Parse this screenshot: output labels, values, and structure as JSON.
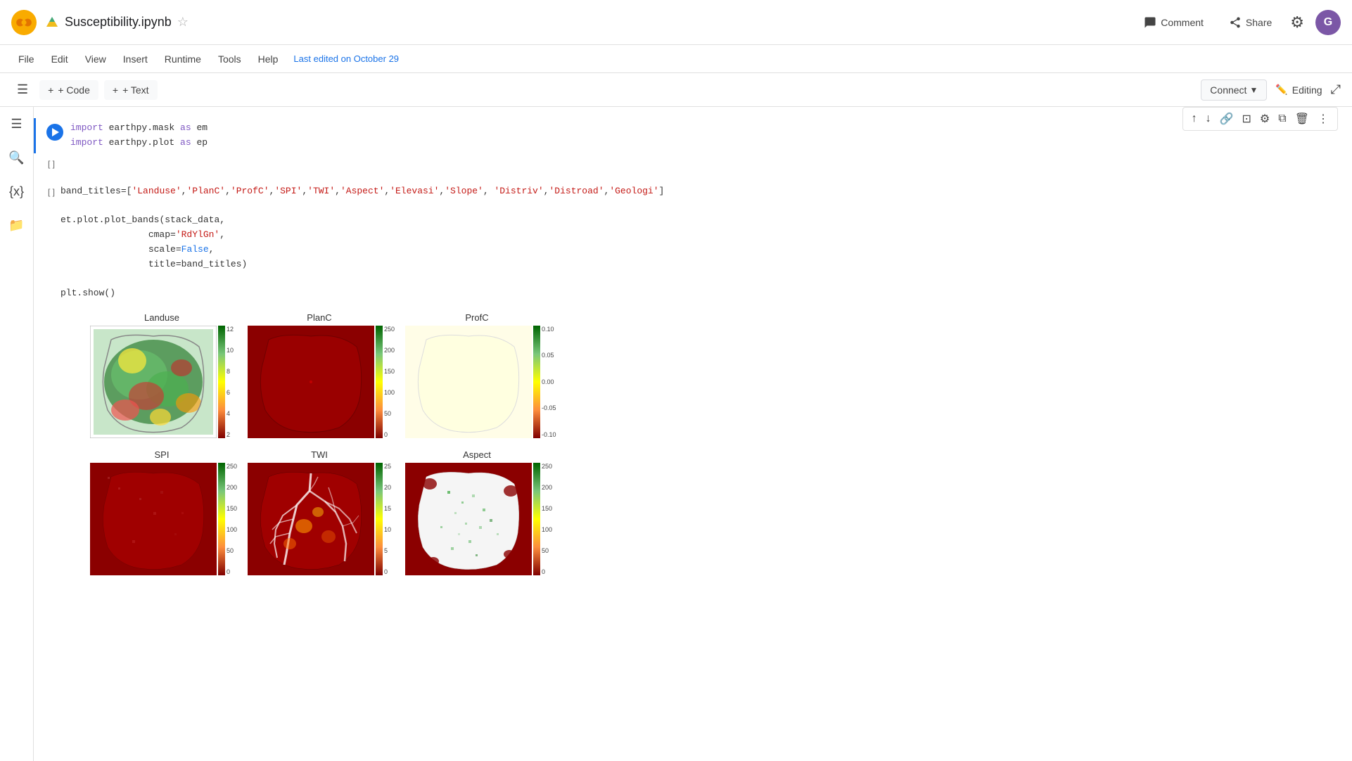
{
  "topbar": {
    "notebook_name": "Susceptibility.ipynb",
    "comment_label": "Comment",
    "share_label": "Share",
    "avatar_letter": "G",
    "last_edited": "Last edited on October 29",
    "editing_label": "Editing"
  },
  "menubar": {
    "items": [
      "File",
      "Edit",
      "View",
      "Insert",
      "Runtime",
      "Tools",
      "Help"
    ]
  },
  "toolbar": {
    "add_code": "+ Code",
    "add_text": "+ Text",
    "connect_label": "Connect"
  },
  "cells": [
    {
      "id": "cell1",
      "type": "code",
      "run_state": "run",
      "bracket": "",
      "lines": [
        "import earthpy.mask as em",
        "import earthpy.plot as ep"
      ]
    },
    {
      "id": "cell2",
      "type": "code",
      "run_state": "empty",
      "bracket": "[ ]",
      "lines": []
    },
    {
      "id": "cell3",
      "type": "code",
      "run_state": "empty",
      "bracket": "[ ]",
      "lines": [
        "band_titles=['Landuse','PlanC','ProfC','SPI','TWI','Aspect','Elevasi','Slope', 'Distriv','Distroad','Geologi']",
        "",
        "et.plot.plot_bands(stack_data,",
        "                cmap='RdYlGn',",
        "                scale=False,",
        "                title=band_titles)",
        "",
        "plt.show()"
      ]
    }
  ],
  "plots": {
    "row1": [
      {
        "title": "Landuse",
        "type": "multicolor",
        "colorbar_min": "2",
        "colorbar_max": "12",
        "colorbar_ticks": [
          "12",
          "10",
          "8",
          "6",
          "4",
          "2"
        ]
      },
      {
        "title": "PlanC",
        "type": "dark_red",
        "colorbar_min": "0",
        "colorbar_max": "250",
        "colorbar_ticks": [
          "250",
          "200",
          "150",
          "100",
          "50",
          "0"
        ]
      },
      {
        "title": "ProfC",
        "type": "light_yellow",
        "colorbar_min": "-0.10",
        "colorbar_max": "0.10",
        "colorbar_ticks": [
          "0.10",
          "0.05",
          "0.00",
          "-0.05",
          "-0.10"
        ]
      }
    ],
    "row2": [
      {
        "title": "SPI",
        "type": "red_map",
        "colorbar_min": "0",
        "colorbar_max": "250",
        "colorbar_ticks": [
          "250",
          "200",
          "150",
          "100",
          "50",
          "0"
        ]
      },
      {
        "title": "TWI",
        "type": "twi_map",
        "colorbar_min": "0",
        "colorbar_max": "25",
        "colorbar_ticks": [
          "25",
          "20",
          "15",
          "10",
          "5",
          "0"
        ]
      },
      {
        "title": "Aspect",
        "type": "aspect_map",
        "colorbar_min": "0",
        "colorbar_max": "250",
        "colorbar_ticks": [
          "250",
          "200",
          "150",
          "100",
          "50",
          "0"
        ]
      }
    ]
  },
  "cell_tools": [
    "↑",
    "↓",
    "🔗",
    "□",
    "⚙",
    "⧉",
    "🗑",
    "⋮"
  ]
}
